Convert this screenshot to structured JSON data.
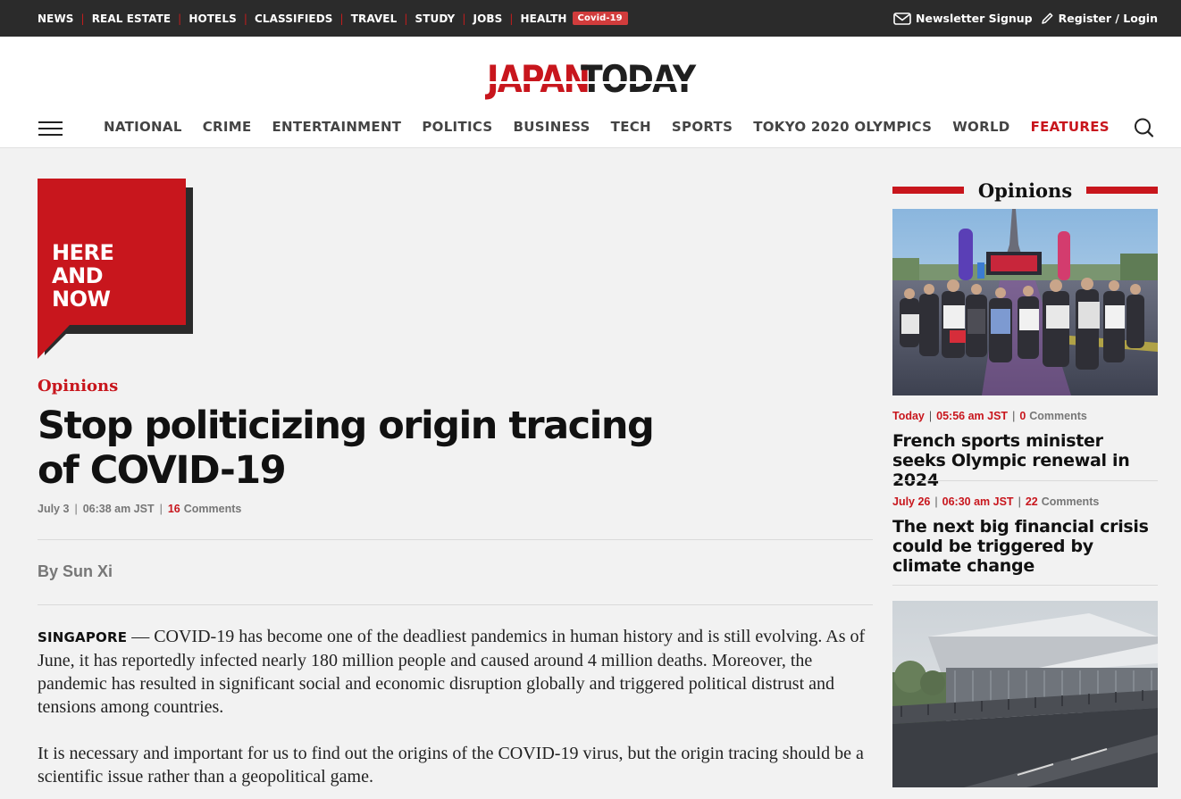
{
  "topbar": {
    "links": [
      "NEWS",
      "REAL ESTATE",
      "HOTELS",
      "CLASSIFIEDS",
      "TRAVEL",
      "STUDY",
      "JOBS",
      "HEALTH"
    ],
    "covid_badge": "Covid-19",
    "newsletter": "Newsletter Signup",
    "login": "Register / Login"
  },
  "logo": {
    "part1": "JAPAN",
    "part2": "TODAY"
  },
  "nav": {
    "items": [
      "NATIONAL",
      "CRIME",
      "ENTERTAINMENT",
      "POLITICS",
      "BUSINESS",
      "TECH",
      "SPORTS",
      "TOKYO 2020 OLYMPICS",
      "WORLD",
      "FEATURES"
    ]
  },
  "badge": {
    "line1": "HERE",
    "line2": "AND",
    "line3": "NOW"
  },
  "article": {
    "category": "Opinions",
    "title_line1": "Stop politicizing origin tracing",
    "title_line2": "of COVID-19",
    "date": "July 3",
    "time": "06:38 am JST",
    "comment_count": "16",
    "comments_label": "Comments",
    "byline": "By Sun Xi",
    "dateline": "SINGAPORE",
    "para1": " — COVID-19 has become one of the deadliest pandemics in human history and is still evolving. As of June, it has reportedly infected nearly 180 million people and caused around 4 million deaths. Moreover, the pandemic has resulted in significant social and economic disruption globally and triggered political distrust and tensions among countries.",
    "para2": "It is necessary and important for us to find out the origins of the COVID-19 virus, but the origin tracing should be a scientific issue rather than a geopolitical game."
  },
  "sidebar": {
    "title": "Opinions",
    "stories": [
      {
        "date": "Today",
        "time": "05:56 am JST",
        "comment_count": "0",
        "comments_label": "Comments",
        "title": "French sports minister seeks Olympic renewal in 2024"
      },
      {
        "date": "July 26",
        "time": "06:30 am JST",
        "comment_count": "22",
        "comments_label": "Comments",
        "title": "The next big financial crisis could be triggered by climate change"
      }
    ]
  },
  "colors": {
    "brand_red": "#c8161d",
    "topbar_bg": "#2b2b2b",
    "page_bg": "#f2f2f2"
  }
}
